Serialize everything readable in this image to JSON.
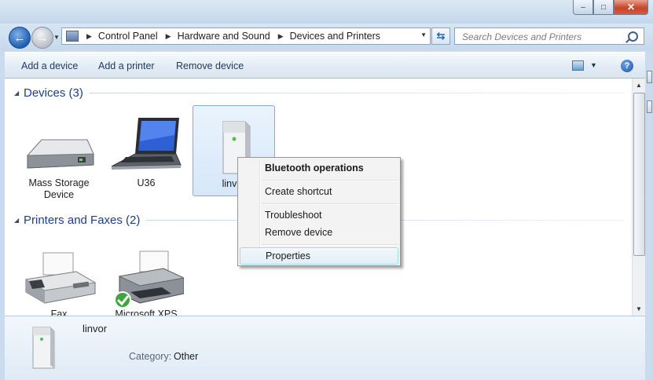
{
  "nav": {
    "breadcrumb": [
      "Control Panel",
      "Hardware and Sound",
      "Devices and Printers"
    ],
    "search_placeholder": "Search Devices and Printers"
  },
  "toolbar": {
    "add_device": "Add a device",
    "add_printer": "Add a printer",
    "remove_device": "Remove device"
  },
  "groups": {
    "devices": {
      "title": "Devices (3)",
      "items": [
        {
          "label_line1": "Mass Storage",
          "label_line2": "Device",
          "icon": "drive-icon"
        },
        {
          "label_line1": "U36",
          "label_line2": "",
          "icon": "laptop-icon"
        },
        {
          "label_line1": "linvor",
          "label_line2": "",
          "icon": "bluetooth-device-icon"
        }
      ]
    },
    "printers": {
      "title": "Printers and Faxes (2)",
      "items": [
        {
          "label_line1": "Fax",
          "icon": "fax-icon"
        },
        {
          "label_line1": "Microsoft XPS",
          "icon": "printer-icon"
        }
      ]
    }
  },
  "context_menu": {
    "items": [
      "Bluetooth operations",
      "Create shortcut",
      "Troubleshoot",
      "Remove device",
      "Properties"
    ],
    "hovered": "Properties"
  },
  "details": {
    "name": "linvor",
    "category_label": "Category:",
    "category_value": "Other"
  },
  "colors": {
    "accent": "#1e3d8a",
    "frame": "#c9dbec",
    "selection": "#d6e7f9"
  }
}
